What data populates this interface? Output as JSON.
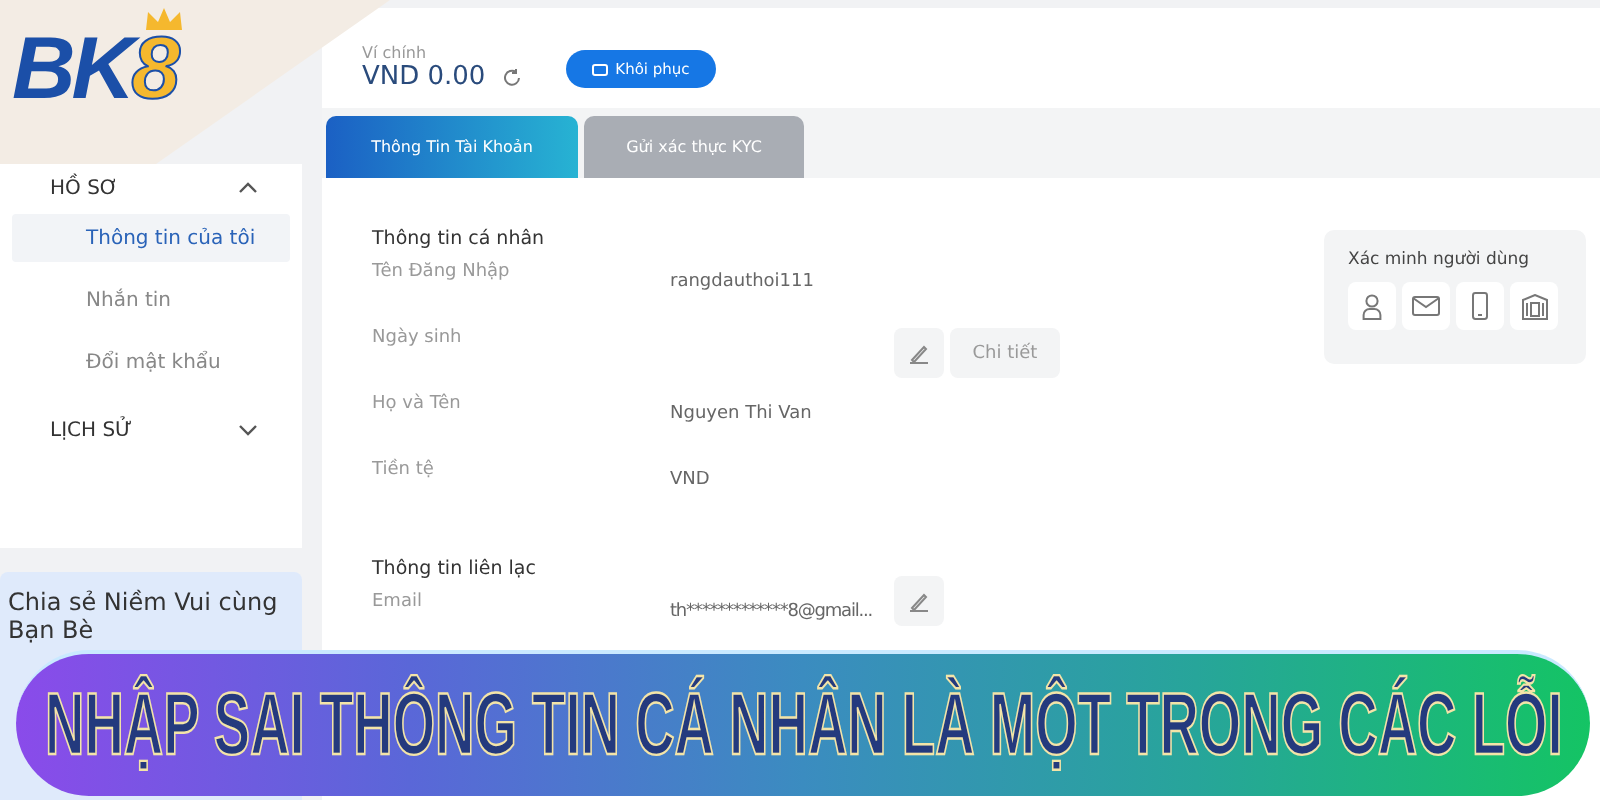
{
  "logo": {
    "main": "BK",
    "accent": "8"
  },
  "sidebar": {
    "groups": [
      {
        "label": "HỒ SƠ",
        "expanded": true,
        "items": [
          {
            "label": "Thông tin của tôi",
            "selected": true
          },
          {
            "label": "Nhắn tin",
            "selected": false
          },
          {
            "label": "Đổi mật khẩu",
            "selected": false
          }
        ]
      },
      {
        "label": "LỊCH SỬ",
        "expanded": false
      }
    ]
  },
  "promo": {
    "title": "Chia sẻ Niềm Vui cùng Bạn Bè"
  },
  "wallet": {
    "label": "Ví chính",
    "balance": "VND 0.00",
    "restore_button": "Khôi phục"
  },
  "tabs": [
    {
      "label": "Thông Tin Tài Khoản",
      "selected": true
    },
    {
      "label": "Gửi xác thực KYC",
      "selected": false
    }
  ],
  "sections": [
    {
      "title": "Thông tin cá nhân",
      "fields": [
        {
          "kind": "plain",
          "label": "Tên Đăng Nhập",
          "value": "rangdauthoi111"
        },
        {
          "kind": "action",
          "label": "Ngày sinh",
          "action": "Chi tiết"
        },
        {
          "kind": "plain",
          "label": "Họ và Tên",
          "value": "Nguyen Thi Van"
        },
        {
          "kind": "plain",
          "label": "Tiền tệ",
          "value": "VND"
        }
      ]
    },
    {
      "title": "Thông tin liên lạc",
      "fields": [
        {
          "kind": "editable",
          "label": "Email",
          "value": "th*************8@gmail..."
        }
      ]
    }
  ],
  "verification": {
    "title": "Xác minh người dùng"
  },
  "banner": {
    "text": "NHẬP SAI THÔNG TIN CÁ NHÂN LÀ MỘT TRONG CÁC LỖI"
  }
}
